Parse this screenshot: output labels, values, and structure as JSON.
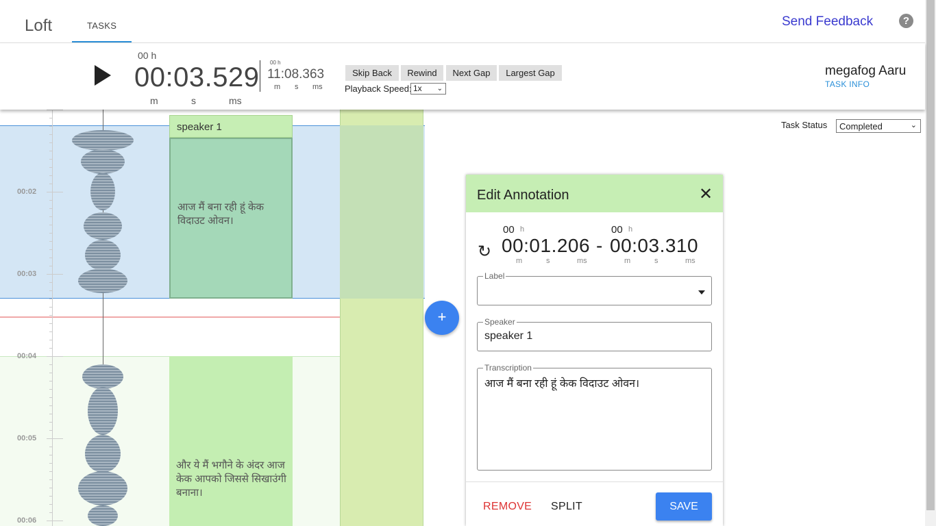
{
  "app": {
    "title": "Loft"
  },
  "nav": {
    "tab_tasks": "TASKS",
    "feedback": "Send Feedback",
    "help_icon": "help-circle-icon"
  },
  "player": {
    "current_hours": "00 h",
    "current_time": "00:03.529",
    "units": [
      "m",
      "s",
      "ms"
    ],
    "duration_hours": "00 h",
    "duration_time": "11:08.363",
    "buttons": {
      "skip_back": "Skip Back",
      "rewind": "Rewind",
      "next_gap": "Next Gap",
      "largest_gap": "Largest Gap"
    },
    "speed_label": "Playback Speed:",
    "speed_value": "1x"
  },
  "user": {
    "name": "megafog Aaru",
    "task_info": "TASK INFO"
  },
  "task_status": {
    "label": "Task Status",
    "value": "Completed"
  },
  "timeline": {
    "time_labels": [
      "00:02",
      "00:03",
      "00:04",
      "00:05",
      "00:06"
    ],
    "segments": [
      {
        "speaker": "speaker 1",
        "text": "आज मैं बना रही हूं केक विदाउट ओवन।"
      },
      {
        "text": "और ये मैं भगौने के अंदर आज केक आपको जिससे सिखाउंगी बनाना।"
      }
    ],
    "add_label": "+"
  },
  "dialog": {
    "title": "Edit Annotation",
    "start_hours": "00",
    "start_time": "00:01.206",
    "dash": "-",
    "end_hours": "00",
    "end_time": "00:03.310",
    "h_unit": "h",
    "units": [
      "m",
      "s",
      "ms"
    ],
    "label_field": {
      "legend": "Label",
      "value": ""
    },
    "speaker_field": {
      "legend": "Speaker",
      "value": "speaker 1"
    },
    "transcription_field": {
      "legend": "Transcription",
      "value": "आज मैं बना रही हूं केक विदाउट ओवन।"
    },
    "buttons": {
      "remove": "REMOVE",
      "split": "SPLIT",
      "save": "SAVE"
    }
  },
  "colors": {
    "accent": "#3b82f0",
    "link": "#2a8fd8",
    "annotation_header": "#c6eeb4",
    "remove": "#dd3333"
  }
}
